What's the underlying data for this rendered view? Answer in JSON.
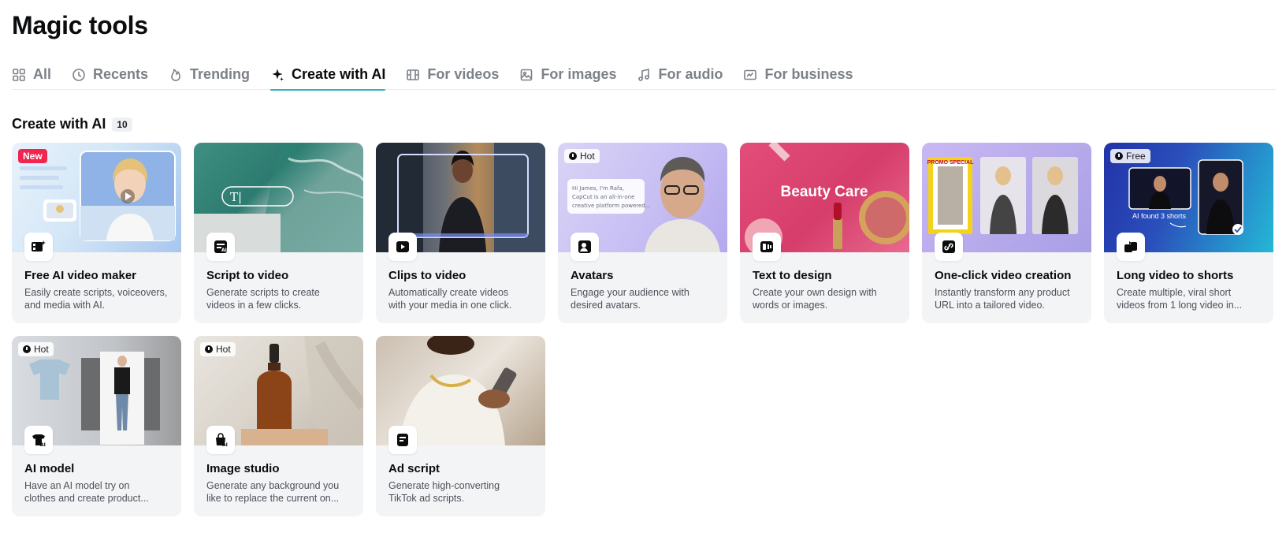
{
  "page": {
    "title": "Magic tools"
  },
  "tabs": [
    {
      "label": "All",
      "icon": "grid-icon",
      "active": false
    },
    {
      "label": "Recents",
      "icon": "clock-icon",
      "active": false
    },
    {
      "label": "Trending",
      "icon": "flame-icon",
      "active": false
    },
    {
      "label": "Create with AI",
      "icon": "sparkle-icon",
      "active": true
    },
    {
      "label": "For videos",
      "icon": "film-icon",
      "active": false
    },
    {
      "label": "For images",
      "icon": "image-icon",
      "active": false
    },
    {
      "label": "For audio",
      "icon": "music-icon",
      "active": false
    },
    {
      "label": "For business",
      "icon": "business-icon",
      "active": false
    }
  ],
  "section": {
    "title": "Create with AI",
    "count": "10"
  },
  "cards": [
    {
      "title": "Free AI video maker",
      "desc": [
        "Easily create scripts, voiceovers,",
        "and media with AI."
      ],
      "badge": "New",
      "icon": "video-magic-icon"
    },
    {
      "title": "Script to video",
      "desc": [
        "Generate scripts to create",
        "videos in a few clicks."
      ],
      "badge": "",
      "icon": "script-ai-icon"
    },
    {
      "title": "Clips to video",
      "desc": [
        "Automatically create videos",
        "with your media in one click."
      ],
      "badge": "",
      "icon": "clips-icon"
    },
    {
      "title": "Avatars",
      "desc": [
        "Engage your audience with",
        "desired avatars."
      ],
      "badge": "Hot",
      "icon": "avatar-icon"
    },
    {
      "title": "Text to design",
      "desc": [
        "Create your own design with",
        "words or images."
      ],
      "badge": "",
      "icon": "text-design-icon"
    },
    {
      "title": "One-click video creation",
      "desc": [
        "Instantly transform any product",
        "URL into a tailored video."
      ],
      "badge": "",
      "icon": "link-video-icon"
    },
    {
      "title": "Long video to shorts",
      "desc": [
        "Create multiple, viral short",
        "videos from 1 long video in..."
      ],
      "badge": "Free",
      "icon": "shorts-icon"
    },
    {
      "title": "AI model",
      "desc": [
        "Have an AI model try on",
        "clothes and create product..."
      ],
      "badge": "Hot",
      "icon": "shirt-ai-icon"
    },
    {
      "title": "Image studio",
      "desc": [
        "Generate any background you",
        "like to replace the current on..."
      ],
      "badge": "Hot",
      "icon": "bag-ai-icon"
    },
    {
      "title": "Ad script",
      "desc": [
        "Generate high-converting",
        "TikTok ad scripts."
      ],
      "badge": "",
      "icon": "document-icon"
    }
  ],
  "thumb_text": {
    "avatars_caption": [
      "Hi James, I'm Rafa,",
      "CapCut is an all-in-one",
      "creative platform powered..."
    ],
    "beauty_title": "Beauty Care",
    "shorts_caption": "AI found 3 shorts",
    "promo_text": "PROMO SPECIAL",
    "script_input": "T|"
  }
}
